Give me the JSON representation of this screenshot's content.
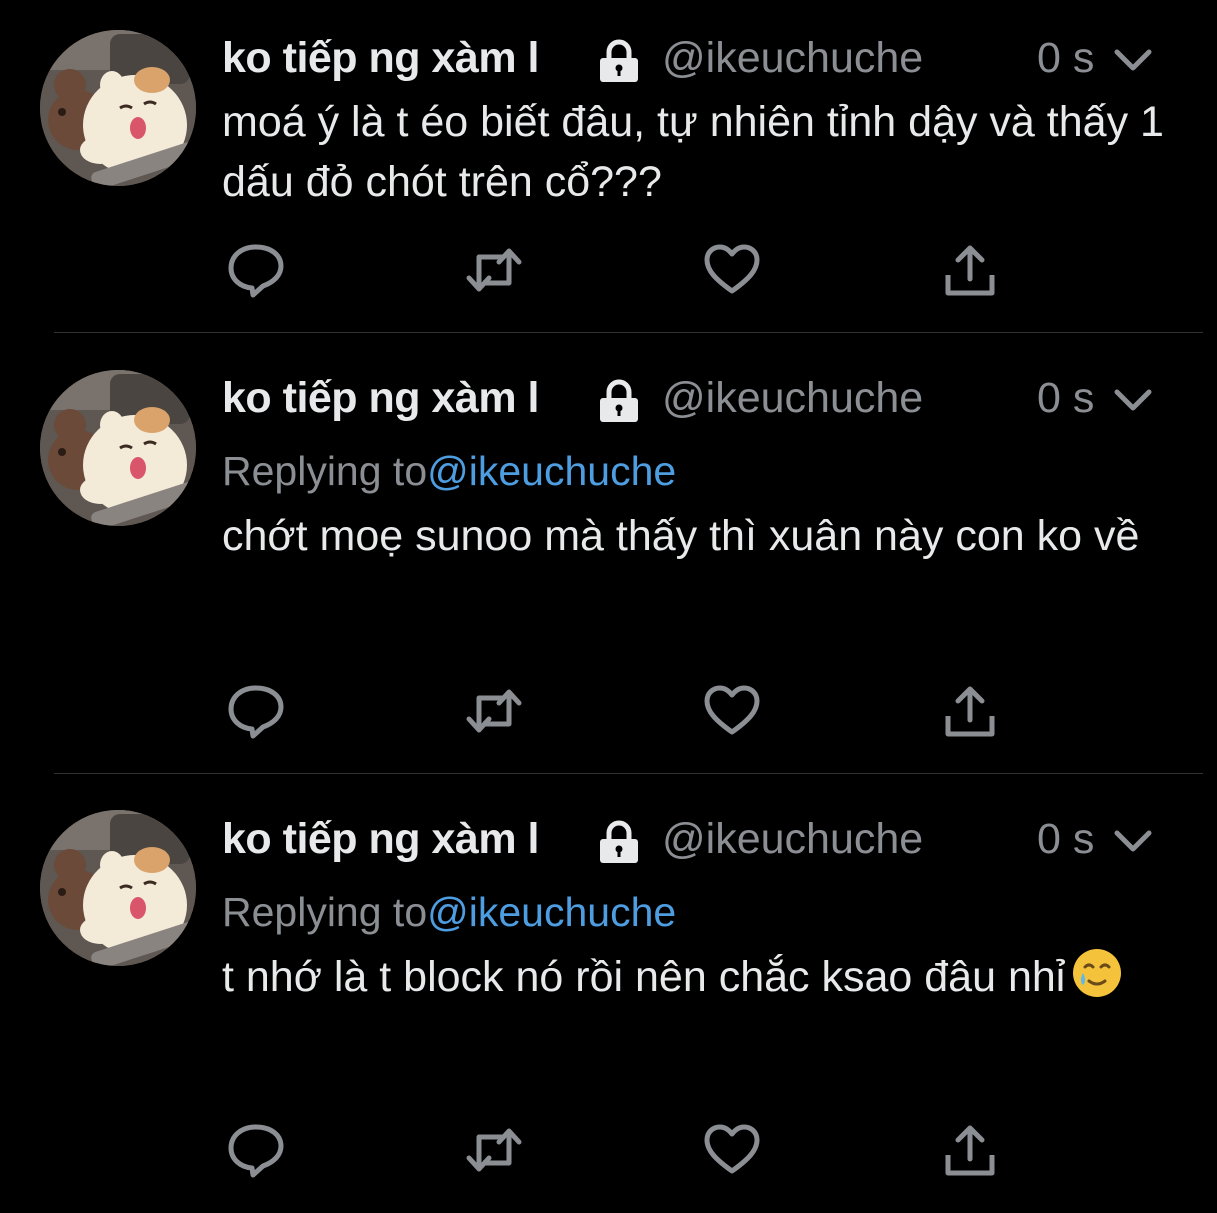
{
  "theme": {
    "background": "#000000",
    "text": "#e7e9ea",
    "muted": "#8b8f94",
    "link": "#4d9de0",
    "divider": "#2f3336"
  },
  "tweets": [
    {
      "display_name": "ko tiếp ng xàm l",
      "handle": "@ikeuchuche",
      "time": "0 s",
      "text": "moá ý là t éo biết đâu, tự nhiên tỉnh dậy và thấy 1 dấu đỏ chót trên cổ???",
      "icons": [
        "avatar",
        "lock-icon",
        "chevron-down-icon",
        "reply-icon",
        "retweet-icon",
        "like-icon",
        "share-icon"
      ]
    },
    {
      "display_name": "ko tiếp ng xàm l",
      "handle": "@ikeuchuche",
      "time": "0 s",
      "replying_label": "Replying to",
      "replying_handle": "@ikeuchuche",
      "text": "chớt moẹ sunoo mà thấy thì xuân này con ko về"
    },
    {
      "display_name": "ko tiếp ng xàm l",
      "handle": "@ikeuchuche",
      "time": "0 s",
      "replying_label": "Replying to",
      "replying_handle": "@ikeuchuche",
      "text": "t nhớ là t block nó rồi nên chắc ksao đâu nhỉ",
      "emoji": "smiling-face-with-tear-icon"
    }
  ]
}
